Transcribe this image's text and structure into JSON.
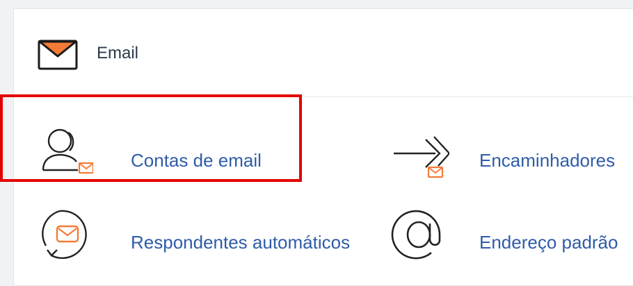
{
  "section": {
    "title": "Email",
    "icon": "envelope-icon"
  },
  "tools": [
    {
      "label": "Contas de email",
      "icon": "user-envelope-icon",
      "highlighted": true
    },
    {
      "label": "Encaminhadores",
      "icon": "forwarder-arrows-icon"
    },
    {
      "label": "Respondentes automáticos",
      "icon": "autoresponder-icon"
    },
    {
      "label": "Endereço padrão",
      "icon": "at-sign-icon"
    }
  ],
  "colors": {
    "accent": "#f47b36",
    "link": "#2f5ca8",
    "highlight": "#e50000",
    "title": "#293a4a"
  }
}
